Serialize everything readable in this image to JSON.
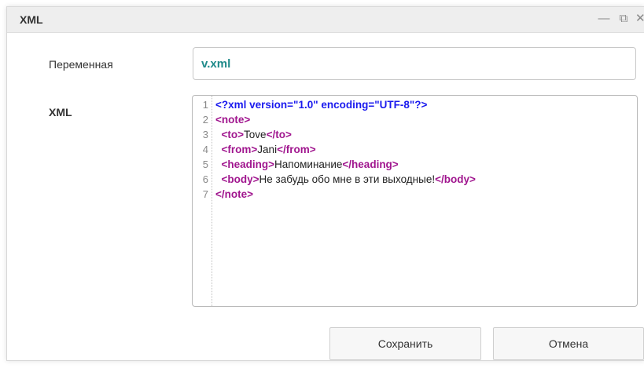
{
  "window": {
    "title": "XML",
    "minimize_glyph": "—",
    "restore_glyph": "⧉",
    "close_glyph": "✕"
  },
  "form": {
    "variable_label": "Переменная",
    "variable_value": "v.xml",
    "xml_label": "XML"
  },
  "editor": {
    "lines": [
      {
        "num": "1",
        "segments": [
          {
            "t": "decl",
            "v": "<?xml version=\"1.0\" encoding=\"UTF-8\"?>"
          }
        ]
      },
      {
        "num": "2",
        "segments": [
          {
            "t": "tag",
            "v": "<note>"
          }
        ]
      },
      {
        "num": "3",
        "segments": [
          {
            "t": "text",
            "v": "  "
          },
          {
            "t": "tag",
            "v": "<to>"
          },
          {
            "t": "text",
            "v": "Tove"
          },
          {
            "t": "tag",
            "v": "</to>"
          }
        ]
      },
      {
        "num": "4",
        "segments": [
          {
            "t": "text",
            "v": "  "
          },
          {
            "t": "tag",
            "v": "<from>"
          },
          {
            "t": "text",
            "v": "Jani"
          },
          {
            "t": "tag",
            "v": "</from>"
          }
        ]
      },
      {
        "num": "5",
        "segments": [
          {
            "t": "text",
            "v": "  "
          },
          {
            "t": "tag",
            "v": "<heading>"
          },
          {
            "t": "text",
            "v": "Напоминание"
          },
          {
            "t": "tag",
            "v": "</heading>"
          }
        ]
      },
      {
        "num": "6",
        "segments": [
          {
            "t": "text",
            "v": "  "
          },
          {
            "t": "tag",
            "v": "<body>"
          },
          {
            "t": "text",
            "v": "Не забудь обо мне в эти выходные!"
          },
          {
            "t": "tag",
            "v": "</body>"
          }
        ]
      },
      {
        "num": "7",
        "segments": [
          {
            "t": "tag",
            "v": "</note>"
          }
        ]
      }
    ]
  },
  "buttons": {
    "save_label": "Сохранить",
    "cancel_label": "Отмена"
  },
  "colors": {
    "tag": "#a0158e",
    "declaration": "#1a1aee",
    "variable_value": "#1f8a8a"
  }
}
